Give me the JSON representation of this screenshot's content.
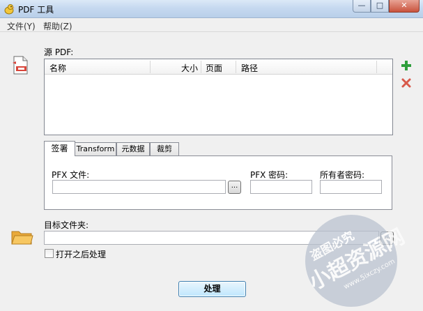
{
  "window": {
    "title": "PDF 工具",
    "controls": {
      "minimize": "—",
      "maximize": "□",
      "close": "✕"
    }
  },
  "menu": {
    "file": "文件(Y)",
    "help": "帮助(Z)"
  },
  "source": {
    "label": "源 PDF:",
    "columns": [
      "名称",
      "大小",
      "页面",
      "路径"
    ]
  },
  "tabs": [
    "签署",
    "Transform",
    "元数据",
    "裁剪"
  ],
  "sign": {
    "pfx_file_label": "PFX 文件:",
    "pfx_password_label": "PFX 密码:",
    "owner_password_label": "所有者密码:",
    "browse": "...",
    "pfx_file_value": "",
    "pfx_password_value": "",
    "owner_password_value": ""
  },
  "target": {
    "label": "目标文件夹:",
    "value": ""
  },
  "open_after": {
    "label": "打开之后处理",
    "checked": false
  },
  "process_button": "处理",
  "watermark": {
    "line1": "盗图必究",
    "line2": "小超资源网",
    "url": "www.5ixczy.com"
  },
  "colors": {
    "add": "#2e9e3b",
    "remove": "#d8594a",
    "folder": "#f2b544"
  }
}
